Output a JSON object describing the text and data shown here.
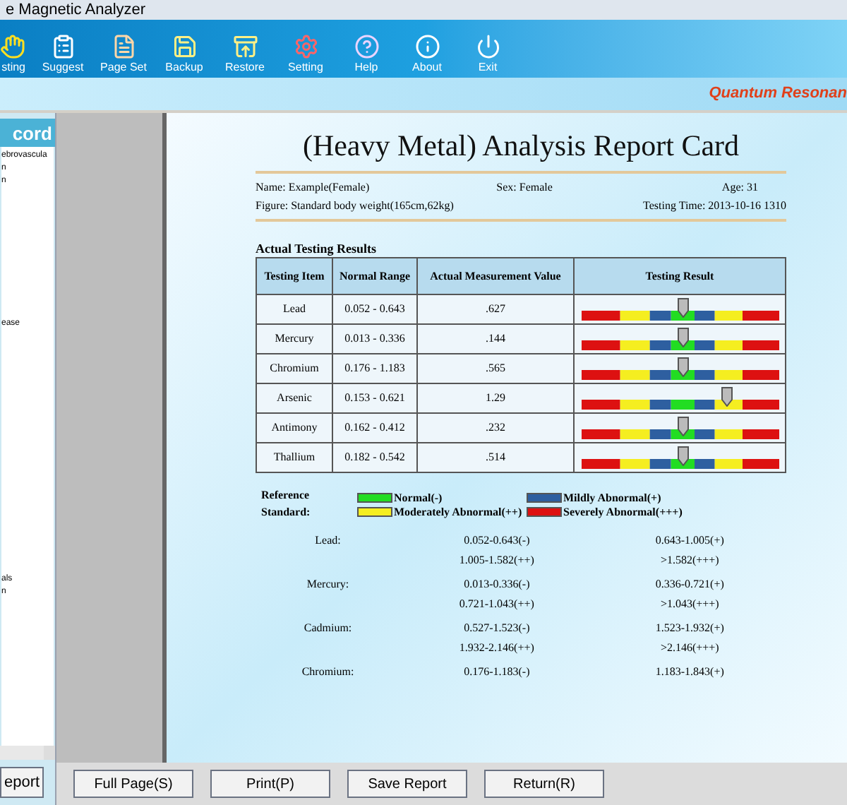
{
  "window": {
    "title": "e Magnetic Analyzer"
  },
  "toolbar": [
    {
      "label": "sting",
      "kind": "hand"
    },
    {
      "label": "Suggest",
      "kind": "clipboard"
    },
    {
      "label": "Page Set",
      "kind": "page"
    },
    {
      "label": "Backup",
      "kind": "save"
    },
    {
      "label": "Restore",
      "kind": "restore"
    },
    {
      "label": "Setting",
      "kind": "gear"
    },
    {
      "label": "Help",
      "kind": "help"
    },
    {
      "label": "About",
      "kind": "info"
    },
    {
      "label": "Exit",
      "kind": "exit"
    }
  ],
  "brand": "Quantum Resonan",
  "sidebar": {
    "title": "cord",
    "groups": [
      [
        "ebrovascula",
        "n",
        "n"
      ],
      [
        "ease"
      ],
      [
        "als",
        "n"
      ]
    ],
    "button": "eport"
  },
  "report": {
    "title": "(Heavy Metal) Analysis Report Card",
    "name": "Name: Example(Female)",
    "sex": "Sex: Female",
    "age": "Age: 31",
    "figure": "Figure: Standard body weight(165cm,62kg)",
    "testing_time": "Testing Time: 2013-10-16 1310",
    "section_title": "Actual Testing Results",
    "columns": [
      "Testing Item",
      "Normal Range",
      "Actual Measurement Value",
      "Testing Result"
    ],
    "rows": [
      {
        "item": "Lead",
        "range": "0.052 - 0.643",
        "value": ".627",
        "level": 0.52
      },
      {
        "item": "Mercury",
        "range": "0.013 - 0.336",
        "value": ".144",
        "level": 0.52
      },
      {
        "item": "Chromium",
        "range": "0.176 - 1.183",
        "value": ".565",
        "level": 0.52
      },
      {
        "item": "Arsenic",
        "range": "0.153 - 0.621",
        "value": "1.29",
        "level": 0.74
      },
      {
        "item": "Antimony",
        "range": "0.162 - 0.412",
        "value": ".232",
        "level": 0.52
      },
      {
        "item": "Thallium",
        "range": "0.182 - 0.542",
        "value": ".514",
        "level": 0.52
      }
    ],
    "reference_label": "Reference Standard:",
    "legend": [
      {
        "label": "Normal(-)",
        "color": "#22dd22"
      },
      {
        "label": "Mildly Abnormal(+)",
        "color": "#2e5fa0"
      },
      {
        "label": "Moderately Abnormal(++)",
        "color": "#f5ee20"
      },
      {
        "label": "Severely Abnormal(+++)",
        "color": "#dd1111"
      }
    ],
    "standards": [
      {
        "name": "Lead:",
        "values": [
          "0.052-0.643(-)",
          "0.643-1.005(+)",
          "1.005-1.582(++)",
          ">1.582(+++)"
        ]
      },
      {
        "name": "Mercury:",
        "values": [
          "0.013-0.336(-)",
          "0.336-0.721(+)",
          "0.721-1.043(++)",
          ">1.043(+++)"
        ]
      },
      {
        "name": "Cadmium:",
        "values": [
          "0.527-1.523(-)",
          "1.523-1.932(+)",
          "1.932-2.146(++)",
          ">2.146(+++)"
        ]
      },
      {
        "name": "Chromium:",
        "values": [
          "0.176-1.183(-)",
          "1.183-1.843(+)"
        ]
      }
    ]
  },
  "buttons": [
    "Full Page(S)",
    "Print(P)",
    "Save Report",
    "Return(R)"
  ]
}
